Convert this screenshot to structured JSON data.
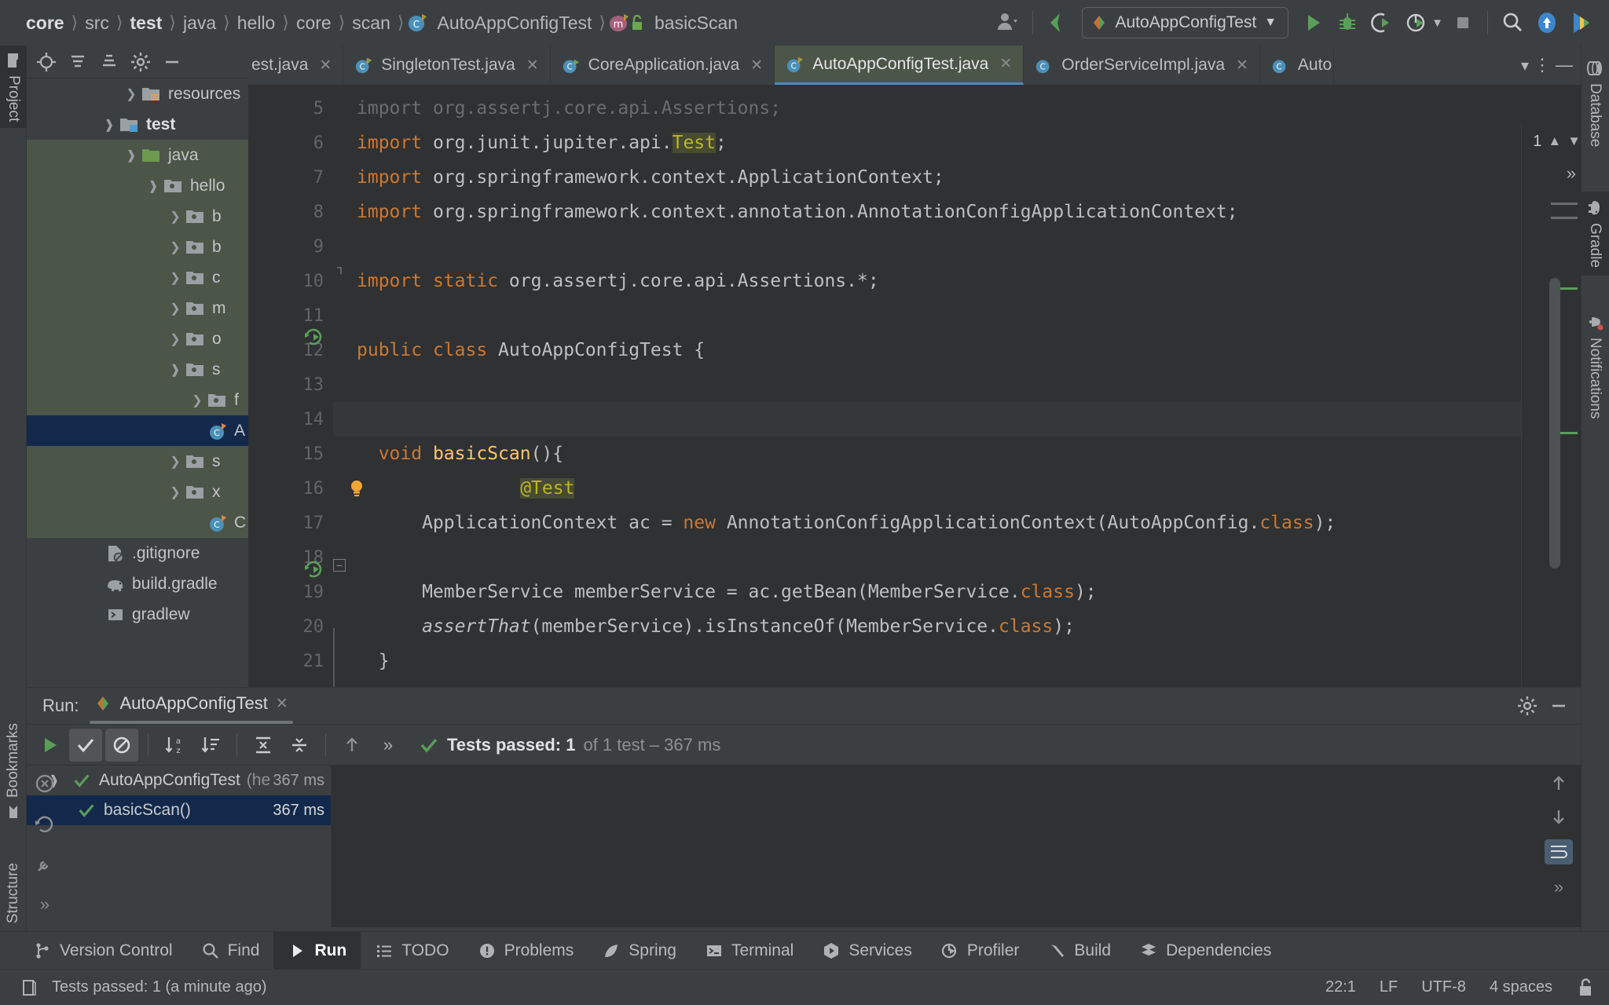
{
  "breadcrumb": {
    "items": [
      {
        "label": "core",
        "bold": true,
        "icon": null
      },
      {
        "label": "src",
        "bold": false,
        "icon": null
      },
      {
        "label": "test",
        "bold": true,
        "icon": null
      },
      {
        "label": "java",
        "bold": false,
        "icon": null
      },
      {
        "label": "hello",
        "bold": false,
        "icon": null
      },
      {
        "label": "core",
        "bold": false,
        "icon": null
      },
      {
        "label": "scan",
        "bold": false,
        "icon": null
      },
      {
        "label": "AutoAppConfigTest",
        "bold": false,
        "icon": "java-class-icon"
      },
      {
        "label": "basicScan",
        "bold": false,
        "icon": "method-icon"
      }
    ]
  },
  "toolbar": {
    "account_label": "account-icon",
    "back_label": "navigate-back-icon",
    "run_config_name": "AutoAppConfigTest",
    "run_label": "run-button",
    "debug_label": "debug-button",
    "coverage_label": "run-with-coverage-button",
    "profile_label": "profile-button",
    "stop_label": "stop-button",
    "search_label": "search-everywhere-button",
    "update_label": "update-project-button",
    "ide_label": "ide-icon"
  },
  "left_strip": {
    "tabs": [
      {
        "label": "Project",
        "icon": "project-folder-icon",
        "active": true
      },
      {
        "label": "Bookmarks",
        "icon": "bookmark-icon",
        "active": false
      },
      {
        "label": "Structure",
        "icon": "structure-icon",
        "active": false
      }
    ],
    "more_label": "»"
  },
  "right_strip": {
    "tabs": [
      {
        "label": "Database",
        "icon": "database-icon",
        "active": false
      },
      {
        "label": "Gradle",
        "icon": "gradle-elephant-icon",
        "active": true
      },
      {
        "label": "Notifications",
        "icon": "notifications-bell-icon",
        "active": false
      }
    ]
  },
  "project_panel": {
    "toolbar_icons": [
      "locate-target-icon",
      "expand-all-icon",
      "collapse-all-icon",
      "settings-gear-icon",
      "hide-panel-icon"
    ],
    "tree": [
      {
        "label": "resources",
        "indent": 3,
        "arrow": "right",
        "icon": "resources-folder-icon",
        "highlight": "none",
        "bold": false
      },
      {
        "label": "test",
        "indent": 2,
        "arrow": "down",
        "icon": "test-folder-icon",
        "highlight": "none",
        "bold": true
      },
      {
        "label": "java",
        "indent": 3,
        "arrow": "down",
        "icon": "java-source-folder-icon",
        "highlight": "green",
        "bold": false
      },
      {
        "label": "hello",
        "indent": 4,
        "arrow": "down",
        "icon": "package-icon",
        "highlight": "green",
        "bold": false
      },
      {
        "label": "b",
        "indent": 5,
        "arrow": "right",
        "icon": "package-icon",
        "highlight": "green",
        "bold": false
      },
      {
        "label": "b",
        "indent": 5,
        "arrow": "right",
        "icon": "package-icon",
        "highlight": "green",
        "bold": false
      },
      {
        "label": "c",
        "indent": 5,
        "arrow": "right",
        "icon": "package-icon",
        "highlight": "green",
        "bold": false
      },
      {
        "label": "m",
        "indent": 5,
        "arrow": "right",
        "icon": "package-icon",
        "highlight": "green",
        "bold": false
      },
      {
        "label": "o",
        "indent": 5,
        "arrow": "right",
        "icon": "package-icon",
        "highlight": "green",
        "bold": false
      },
      {
        "label": "s",
        "indent": 5,
        "arrow": "down",
        "icon": "package-icon",
        "highlight": "green",
        "bold": false
      },
      {
        "label": "f",
        "indent": 6,
        "arrow": "right",
        "icon": "package-icon",
        "highlight": "green",
        "bold": false
      },
      {
        "label": "A",
        "indent": 6,
        "arrow": "none",
        "icon": "java-class-icon",
        "highlight": "blue",
        "bold": false
      },
      {
        "label": "s",
        "indent": 5,
        "arrow": "right",
        "icon": "package-icon",
        "highlight": "green",
        "bold": false
      },
      {
        "label": "x",
        "indent": 5,
        "arrow": "right",
        "icon": "package-icon",
        "highlight": "green",
        "bold": false
      },
      {
        "label": "C",
        "indent": 5,
        "arrow": "none",
        "icon": "java-class-icon",
        "highlight": "green",
        "bold": false
      }
    ],
    "files": [
      {
        "label": ".gitignore",
        "icon": "gitignore-file-icon"
      },
      {
        "label": "build.gradle",
        "icon": "gradle-elephant-icon"
      },
      {
        "label": "gradlew",
        "icon": "shell-script-icon"
      }
    ]
  },
  "editor": {
    "tabs": [
      {
        "label": "est.java",
        "icon": "java-class-icon",
        "active": false,
        "clipped": true
      },
      {
        "label": "SingletonTest.java",
        "icon": "java-class-icon",
        "active": false
      },
      {
        "label": "CoreApplication.java",
        "icon": "spring-class-icon",
        "active": false
      },
      {
        "label": "AutoAppConfigTest.java",
        "icon": "java-class-icon",
        "active": true
      },
      {
        "label": "OrderServiceImpl.java",
        "icon": "java-class-icon",
        "active": false
      },
      {
        "label": "Auto",
        "icon": "java-class-icon",
        "active": false,
        "clipped": true
      }
    ],
    "tab_overflow_icon": "chevron-down-icon",
    "tab_options_icon": "more-vertical-icon",
    "hide_icon": "hide-panel-icon",
    "warning_count": "1",
    "warning_icon": "warning-triangle-icon",
    "prev_icon": "chevron-up-icon",
    "next_icon": "chevron-down-icon",
    "expand_icon": "»",
    "first_line_number": 5,
    "lines": [
      {
        "n": 5,
        "tokens": [
          {
            "t": "import org.assertj.core.api.Assertions;",
            "c": "grey"
          }
        ]
      },
      {
        "n": 6,
        "tokens": [
          {
            "t": "import",
            "c": "kw"
          },
          {
            "t": " org.junit.jupiter.api.",
            "c": ""
          },
          {
            "t": "Test",
            "c": "hlbg"
          },
          {
            "t": ";",
            "c": ""
          }
        ]
      },
      {
        "n": 7,
        "tokens": [
          {
            "t": "import",
            "c": "kw"
          },
          {
            "t": " org.springframework.context.ApplicationContext;",
            "c": ""
          }
        ]
      },
      {
        "n": 8,
        "tokens": [
          {
            "t": "import",
            "c": "kw"
          },
          {
            "t": " org.springframework.context.annotation.AnnotationConfigApplicationContext;",
            "c": ""
          }
        ]
      },
      {
        "n": 9,
        "tokens": [
          {
            "t": "",
            "c": ""
          }
        ]
      },
      {
        "n": 10,
        "tokens": [
          {
            "t": "import",
            "c": "kw"
          },
          {
            "t": " ",
            "c": ""
          },
          {
            "t": "static",
            "c": "kw"
          },
          {
            "t": " org.assertj.core.api.Assertions.*;",
            "c": ""
          }
        ]
      },
      {
        "n": 11,
        "tokens": [
          {
            "t": "",
            "c": ""
          }
        ]
      },
      {
        "n": 12,
        "tokens": [
          {
            "t": "public",
            "c": "kw"
          },
          {
            "t": " ",
            "c": ""
          },
          {
            "t": "class",
            "c": "kw"
          },
          {
            "t": " AutoAppConfigTest {",
            "c": ""
          }
        ]
      },
      {
        "n": 13,
        "tokens": [
          {
            "t": "",
            "c": ""
          }
        ]
      },
      {
        "n": 14,
        "tokens": [
          {
            "t": "  ",
            "c": ""
          },
          {
            "t": "@Test",
            "c": "ann hlbg"
          }
        ]
      },
      {
        "n": 15,
        "tokens": [
          {
            "t": "  ",
            "c": ""
          },
          {
            "t": "void",
            "c": "kw"
          },
          {
            "t": " ",
            "c": ""
          },
          {
            "t": "basicScan",
            "c": "meth"
          },
          {
            "t": "(){",
            "c": ""
          }
        ]
      },
      {
        "n": 16,
        "tokens": [
          {
            "t": "",
            "c": ""
          }
        ]
      },
      {
        "n": 17,
        "tokens": [
          {
            "t": "      ApplicationContext ac = ",
            "c": ""
          },
          {
            "t": "new",
            "c": "kw"
          },
          {
            "t": " AnnotationConfigApplicationContext(AutoAppConfig.",
            "c": ""
          },
          {
            "t": "class",
            "c": "kw"
          },
          {
            "t": ");",
            "c": ""
          }
        ]
      },
      {
        "n": 18,
        "tokens": [
          {
            "t": "",
            "c": ""
          }
        ]
      },
      {
        "n": 19,
        "tokens": [
          {
            "t": "      MemberService memberService = ac.getBean(MemberService.",
            "c": ""
          },
          {
            "t": "class",
            "c": "kw"
          },
          {
            "t": ");",
            "c": ""
          }
        ]
      },
      {
        "n": 20,
        "tokens": [
          {
            "t": "      ",
            "c": ""
          },
          {
            "t": "assertThat",
            "c": "ital"
          },
          {
            "t": "(memberService).isInstanceOf(MemberService.",
            "c": ""
          },
          {
            "t": "class",
            "c": "kw"
          },
          {
            "t": ");",
            "c": ""
          }
        ]
      },
      {
        "n": 21,
        "tokens": [
          {
            "t": "  }",
            "c": ""
          }
        ]
      }
    ]
  },
  "run_panel": {
    "title": "Run:",
    "tab_label": "AutoAppConfigTest",
    "tab_icon": "run-config-icon",
    "tab_close_icon": "close-icon",
    "settings_icon": "settings-gear-icon",
    "hide_icon": "hide-panel-icon",
    "toolbar": {
      "rerun_icon": "rerun-button",
      "show_passed_icon": "show-passed-toggle",
      "show_ignored_icon": "show-ignored-toggle",
      "sort_alpha_icon": "sort-alphabetically-button",
      "sort_duration_icon": "sort-by-duration-button",
      "expand_all_icon": "expand-all-button",
      "collapse_all_icon": "collapse-all-button",
      "prev_icon": "previous-occurrence-button",
      "more_icon": "»"
    },
    "status": {
      "check_icon": "green-check-icon",
      "primary": "Tests passed: 1",
      "secondary": "of 1 test – 367 ms"
    },
    "tests": [
      {
        "label": "AutoAppConfigTest",
        "suffix": "(he",
        "duration": "367 ms",
        "arrow": "down",
        "selected": false,
        "indent": 1
      },
      {
        "label": "basicScan()",
        "suffix": "",
        "duration": "367 ms",
        "arrow": "none",
        "selected": true,
        "indent": 2
      }
    ],
    "side_icons": [
      "rerun-failed-icon",
      "rerun-automatically-icon",
      "test-settings-icon",
      "more-icon"
    ],
    "console_icons": [
      "scroll-up-icon",
      "scroll-down-icon",
      "soft-wrap-icon",
      "expand-icon"
    ]
  },
  "tool_windows": [
    {
      "label": "Version Control",
      "icon": "branch-icon",
      "active": false
    },
    {
      "label": "Find",
      "icon": "search-icon",
      "active": false
    },
    {
      "label": "Run",
      "icon": "run-triangle-icon",
      "active": true
    },
    {
      "label": "TODO",
      "icon": "todo-list-icon",
      "active": false
    },
    {
      "label": "Problems",
      "icon": "problems-icon",
      "active": false
    },
    {
      "label": "Spring",
      "icon": "spring-leaf-icon",
      "active": false
    },
    {
      "label": "Terminal",
      "icon": "terminal-icon",
      "active": false
    },
    {
      "label": "Services",
      "icon": "services-icon",
      "active": false
    },
    {
      "label": "Profiler",
      "icon": "profiler-icon",
      "active": false
    },
    {
      "label": "Build",
      "icon": "build-hammer-icon",
      "active": false
    },
    {
      "label": "Dependencies",
      "icon": "dependencies-icon",
      "active": false
    }
  ],
  "status_bar": {
    "message_icon": "event-log-icon",
    "message": "Tests passed: 1 (a minute ago)",
    "caret": "22:1",
    "line_separator": "LF",
    "encoding": "UTF-8",
    "indent": "4 spaces",
    "lock_icon": "unlocked-icon"
  },
  "colors": {
    "background": "#3c3f41",
    "editor_background": "#2f3133",
    "selection_green": "#4b5548",
    "selection_blue": "#13294b",
    "keyword_orange": "#cc7832",
    "annotation_yellow": "#bbb529",
    "method_yellow": "#ffc66d",
    "accent_green": "#59a869",
    "accent_blue": "#4a88c7"
  }
}
